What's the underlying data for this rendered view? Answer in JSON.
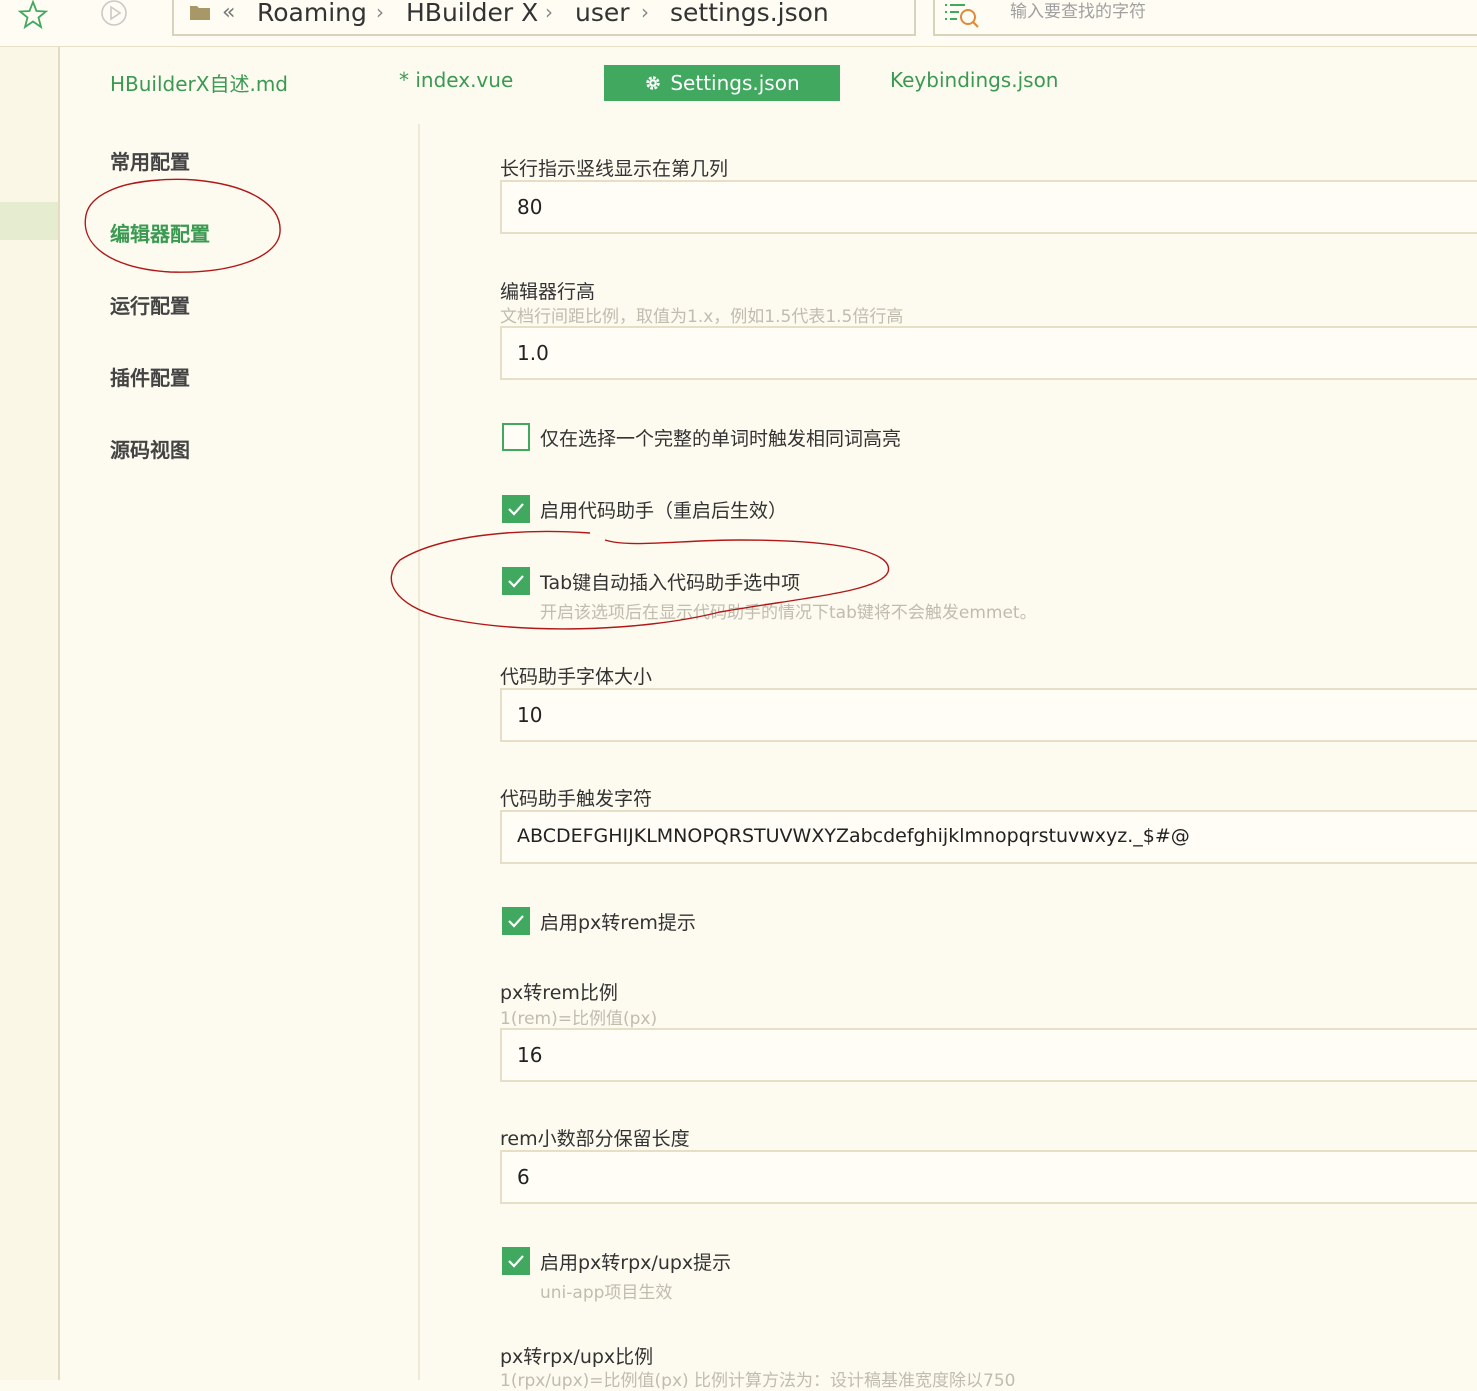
{
  "toolbar": {
    "breadcrumb": [
      "Roaming",
      "HBuilder X",
      "user",
      "settings.json"
    ],
    "search_placeholder": "输入要查找的字符"
  },
  "tabs": [
    {
      "label": "HBuilderX自述.md",
      "active": false
    },
    {
      "label": "* index.vue",
      "active": false
    },
    {
      "label": "Settings.json",
      "active": true
    },
    {
      "label": "Keybindings.json",
      "active": false
    }
  ],
  "sidebar": {
    "items": [
      {
        "label": "常用配置",
        "active": false
      },
      {
        "label": "编辑器配置",
        "active": true
      },
      {
        "label": "运行配置",
        "active": false
      },
      {
        "label": "插件配置",
        "active": false
      },
      {
        "label": "源码视图",
        "active": false
      }
    ]
  },
  "settings": {
    "ruler": {
      "label": "长行指示竖线显示在第几列",
      "value": "80"
    },
    "line_height": {
      "label": "编辑器行高",
      "hint": "文档行间距比例，取值为1.x，例如1.5代表1.5倍行高",
      "value": "1.0"
    },
    "highlight_word": {
      "label": "仅在选择一个完整的单词时触发相同词高亮",
      "checked": false
    },
    "code_assist": {
      "label": "启用代码助手（重启后生效）",
      "checked": true
    },
    "tab_insert": {
      "label": "Tab键自动插入代码助手选中项",
      "hint": "开启该选项后在显示代码助手的情况下tab键将不会触发emmet。",
      "checked": true
    },
    "assist_font_size": {
      "label": "代码助手字体大小",
      "value": "10"
    },
    "assist_trigger_chars": {
      "label": "代码助手触发字符",
      "value": "ABCDEFGHIJKLMNOPQRSTUVWXYZabcdefghijklmnopqrstuvwxyz._$#@"
    },
    "px_rem_hint": {
      "label": "启用px转rem提示",
      "checked": true
    },
    "px_rem_ratio": {
      "label": "px转rem比例",
      "hint": "1(rem)=比例值(px)",
      "value": "16"
    },
    "rem_decimals": {
      "label": "rem小数部分保留长度",
      "value": "6"
    },
    "px_rpx_hint": {
      "label": "启用px转rpx/upx提示",
      "hint": "uni-app项目生效",
      "checked": true
    },
    "px_rpx_ratio": {
      "label": "px转rpx/upx比例",
      "hint": "1(rpx/upx)=比例值(px) 比例计算方法为：设计稿基准宽度除以750"
    }
  },
  "colors": {
    "accent": "#41a85f",
    "background": "#fdfaef",
    "annotation": "#b01818"
  }
}
